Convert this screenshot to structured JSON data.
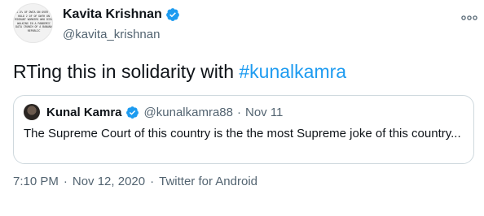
{
  "author": {
    "display_name": "Kavita Krishnan",
    "handle": "@kavita_krishnan",
    "verified": true,
    "avatar_text": "10.5% OF DWTA ON OVER 18 HOLD 2 OF OF DWTH ON MIGRANT WORKERS WHO DIED WALKING IN A PANDEMIC DATA CRUNCH OF A BANANA REPUBLIC"
  },
  "tweet": {
    "text_prefix": "RTing this in solidarity with ",
    "hashtag": "#kunalkamra"
  },
  "quoted": {
    "display_name": "Kunal Kamra",
    "handle": "@kunalkamra88",
    "separator": "·",
    "date": "Nov 11",
    "text": "The Supreme Court of this country is the the most Supreme joke of this country..."
  },
  "meta": {
    "time": "7:10 PM",
    "separator": "·",
    "date": "Nov 12, 2020",
    "source": "Twitter for Android"
  },
  "icons": {
    "verified": "verified-badge-icon",
    "more": "more-options-icon"
  },
  "colors": {
    "link": "#1d9bf0",
    "secondary_text": "#536471",
    "border": "#cfd9de"
  }
}
